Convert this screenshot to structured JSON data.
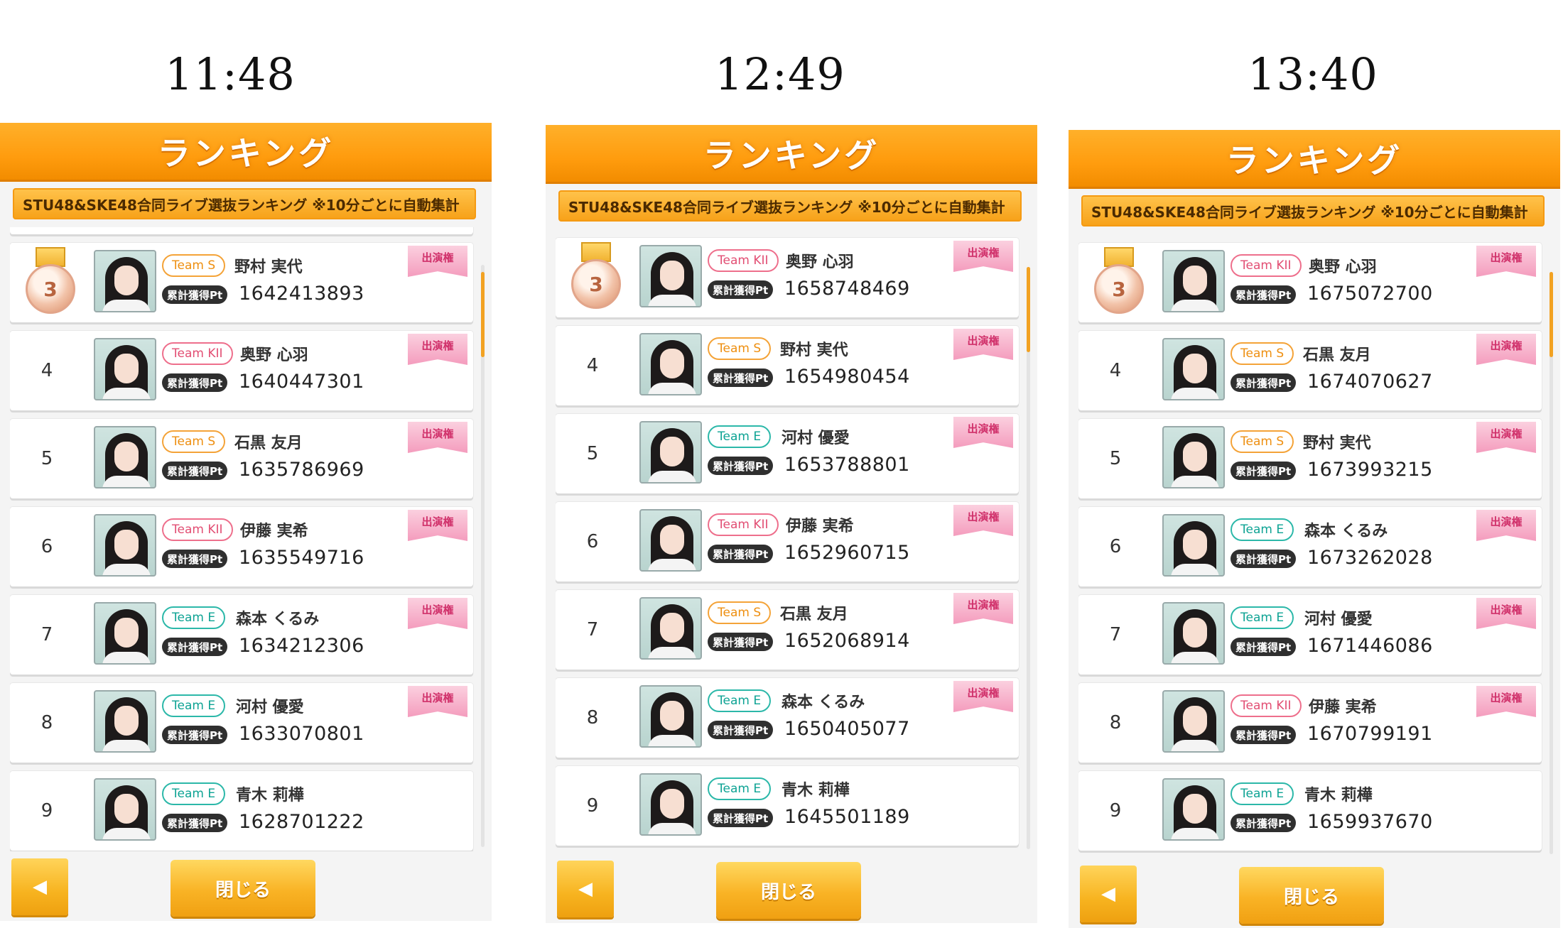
{
  "panels": [
    {
      "time": "11:48",
      "title": "ランキング",
      "subtitle": "STU48&SKE48合同ライブ選抜ランキング ※10分ごとに自動集計",
      "entries": [
        {
          "rank": "3",
          "team": "Team S",
          "team_style": "s",
          "name": "野村 実代",
          "pt_label": "累計獲得Pt",
          "points": "1642413893",
          "badge": "出演権"
        },
        {
          "rank": "4",
          "team": "Team KII",
          "team_style": "kii",
          "name": "奥野 心羽",
          "pt_label": "累計獲得Pt",
          "points": "1640447301",
          "badge": "出演権"
        },
        {
          "rank": "5",
          "team": "Team S",
          "team_style": "s",
          "name": "石黒 友月",
          "pt_label": "累計獲得Pt",
          "points": "1635786969",
          "badge": "出演権"
        },
        {
          "rank": "6",
          "team": "Team KII",
          "team_style": "kii",
          "name": "伊藤 実希",
          "pt_label": "累計獲得Pt",
          "points": "1635549716",
          "badge": "出演権"
        },
        {
          "rank": "7",
          "team": "Team E",
          "team_style": "e",
          "name": "森本 くるみ",
          "pt_label": "累計獲得Pt",
          "points": "1634212306",
          "badge": "出演権"
        },
        {
          "rank": "8",
          "team": "Team E",
          "team_style": "e",
          "name": "河村 優愛",
          "pt_label": "累計獲得Pt",
          "points": "1633070801",
          "badge": "出演権"
        },
        {
          "rank": "9",
          "team": "Team E",
          "team_style": "e",
          "name": "青木 莉樺",
          "pt_label": "累計獲得Pt",
          "points": "1628701222",
          "badge": ""
        }
      ],
      "back_label": "◀",
      "close_label": "閉じる"
    },
    {
      "time": "12:49",
      "title": "ランキング",
      "subtitle": "STU48&SKE48合同ライブ選抜ランキング ※10分ごとに自動集計",
      "entries": [
        {
          "rank": "3",
          "team": "Team KII",
          "team_style": "kii",
          "name": "奥野 心羽",
          "pt_label": "累計獲得Pt",
          "points": "1658748469",
          "badge": "出演権"
        },
        {
          "rank": "4",
          "team": "Team S",
          "team_style": "s",
          "name": "野村 実代",
          "pt_label": "累計獲得Pt",
          "points": "1654980454",
          "badge": "出演権"
        },
        {
          "rank": "5",
          "team": "Team E",
          "team_style": "e",
          "name": "河村 優愛",
          "pt_label": "累計獲得Pt",
          "points": "1653788801",
          "badge": "出演権"
        },
        {
          "rank": "6",
          "team": "Team KII",
          "team_style": "kii",
          "name": "伊藤 実希",
          "pt_label": "累計獲得Pt",
          "points": "1652960715",
          "badge": "出演権"
        },
        {
          "rank": "7",
          "team": "Team S",
          "team_style": "s",
          "name": "石黒 友月",
          "pt_label": "累計獲得Pt",
          "points": "1652068914",
          "badge": "出演権"
        },
        {
          "rank": "8",
          "team": "Team E",
          "team_style": "e",
          "name": "森本 くるみ",
          "pt_label": "累計獲得Pt",
          "points": "1650405077",
          "badge": "出演権"
        },
        {
          "rank": "9",
          "team": "Team E",
          "team_style": "e",
          "name": "青木 莉樺",
          "pt_label": "累計獲得Pt",
          "points": "1645501189",
          "badge": ""
        }
      ],
      "back_label": "◀",
      "close_label": "閉じる"
    },
    {
      "time": "13:40",
      "title": "ランキング",
      "subtitle": "STU48&SKE48合同ライブ選抜ランキング ※10分ごとに自動集計",
      "entries": [
        {
          "rank": "3",
          "team": "Team KII",
          "team_style": "kii",
          "name": "奥野 心羽",
          "pt_label": "累計獲得Pt",
          "points": "1675072700",
          "badge": "出演権"
        },
        {
          "rank": "4",
          "team": "Team S",
          "team_style": "s",
          "name": "石黒 友月",
          "pt_label": "累計獲得Pt",
          "points": "1674070627",
          "badge": "出演権"
        },
        {
          "rank": "5",
          "team": "Team S",
          "team_style": "s",
          "name": "野村 実代",
          "pt_label": "累計獲得Pt",
          "points": "1673993215",
          "badge": "出演権"
        },
        {
          "rank": "6",
          "team": "Team E",
          "team_style": "e",
          "name": "森本 くるみ",
          "pt_label": "累計獲得Pt",
          "points": "1673262028",
          "badge": "出演権"
        },
        {
          "rank": "7",
          "team": "Team E",
          "team_style": "e",
          "name": "河村 優愛",
          "pt_label": "累計獲得Pt",
          "points": "1671446086",
          "badge": "出演権"
        },
        {
          "rank": "8",
          "team": "Team KII",
          "team_style": "kii",
          "name": "伊藤 実希",
          "pt_label": "累計獲得Pt",
          "points": "1670799191",
          "badge": "出演権"
        },
        {
          "rank": "9",
          "team": "Team E",
          "team_style": "e",
          "name": "青木 莉樺",
          "pt_label": "累計獲得Pt",
          "points": "1659937670",
          "badge": ""
        }
      ],
      "back_label": "◀",
      "close_label": "閉じる"
    }
  ]
}
